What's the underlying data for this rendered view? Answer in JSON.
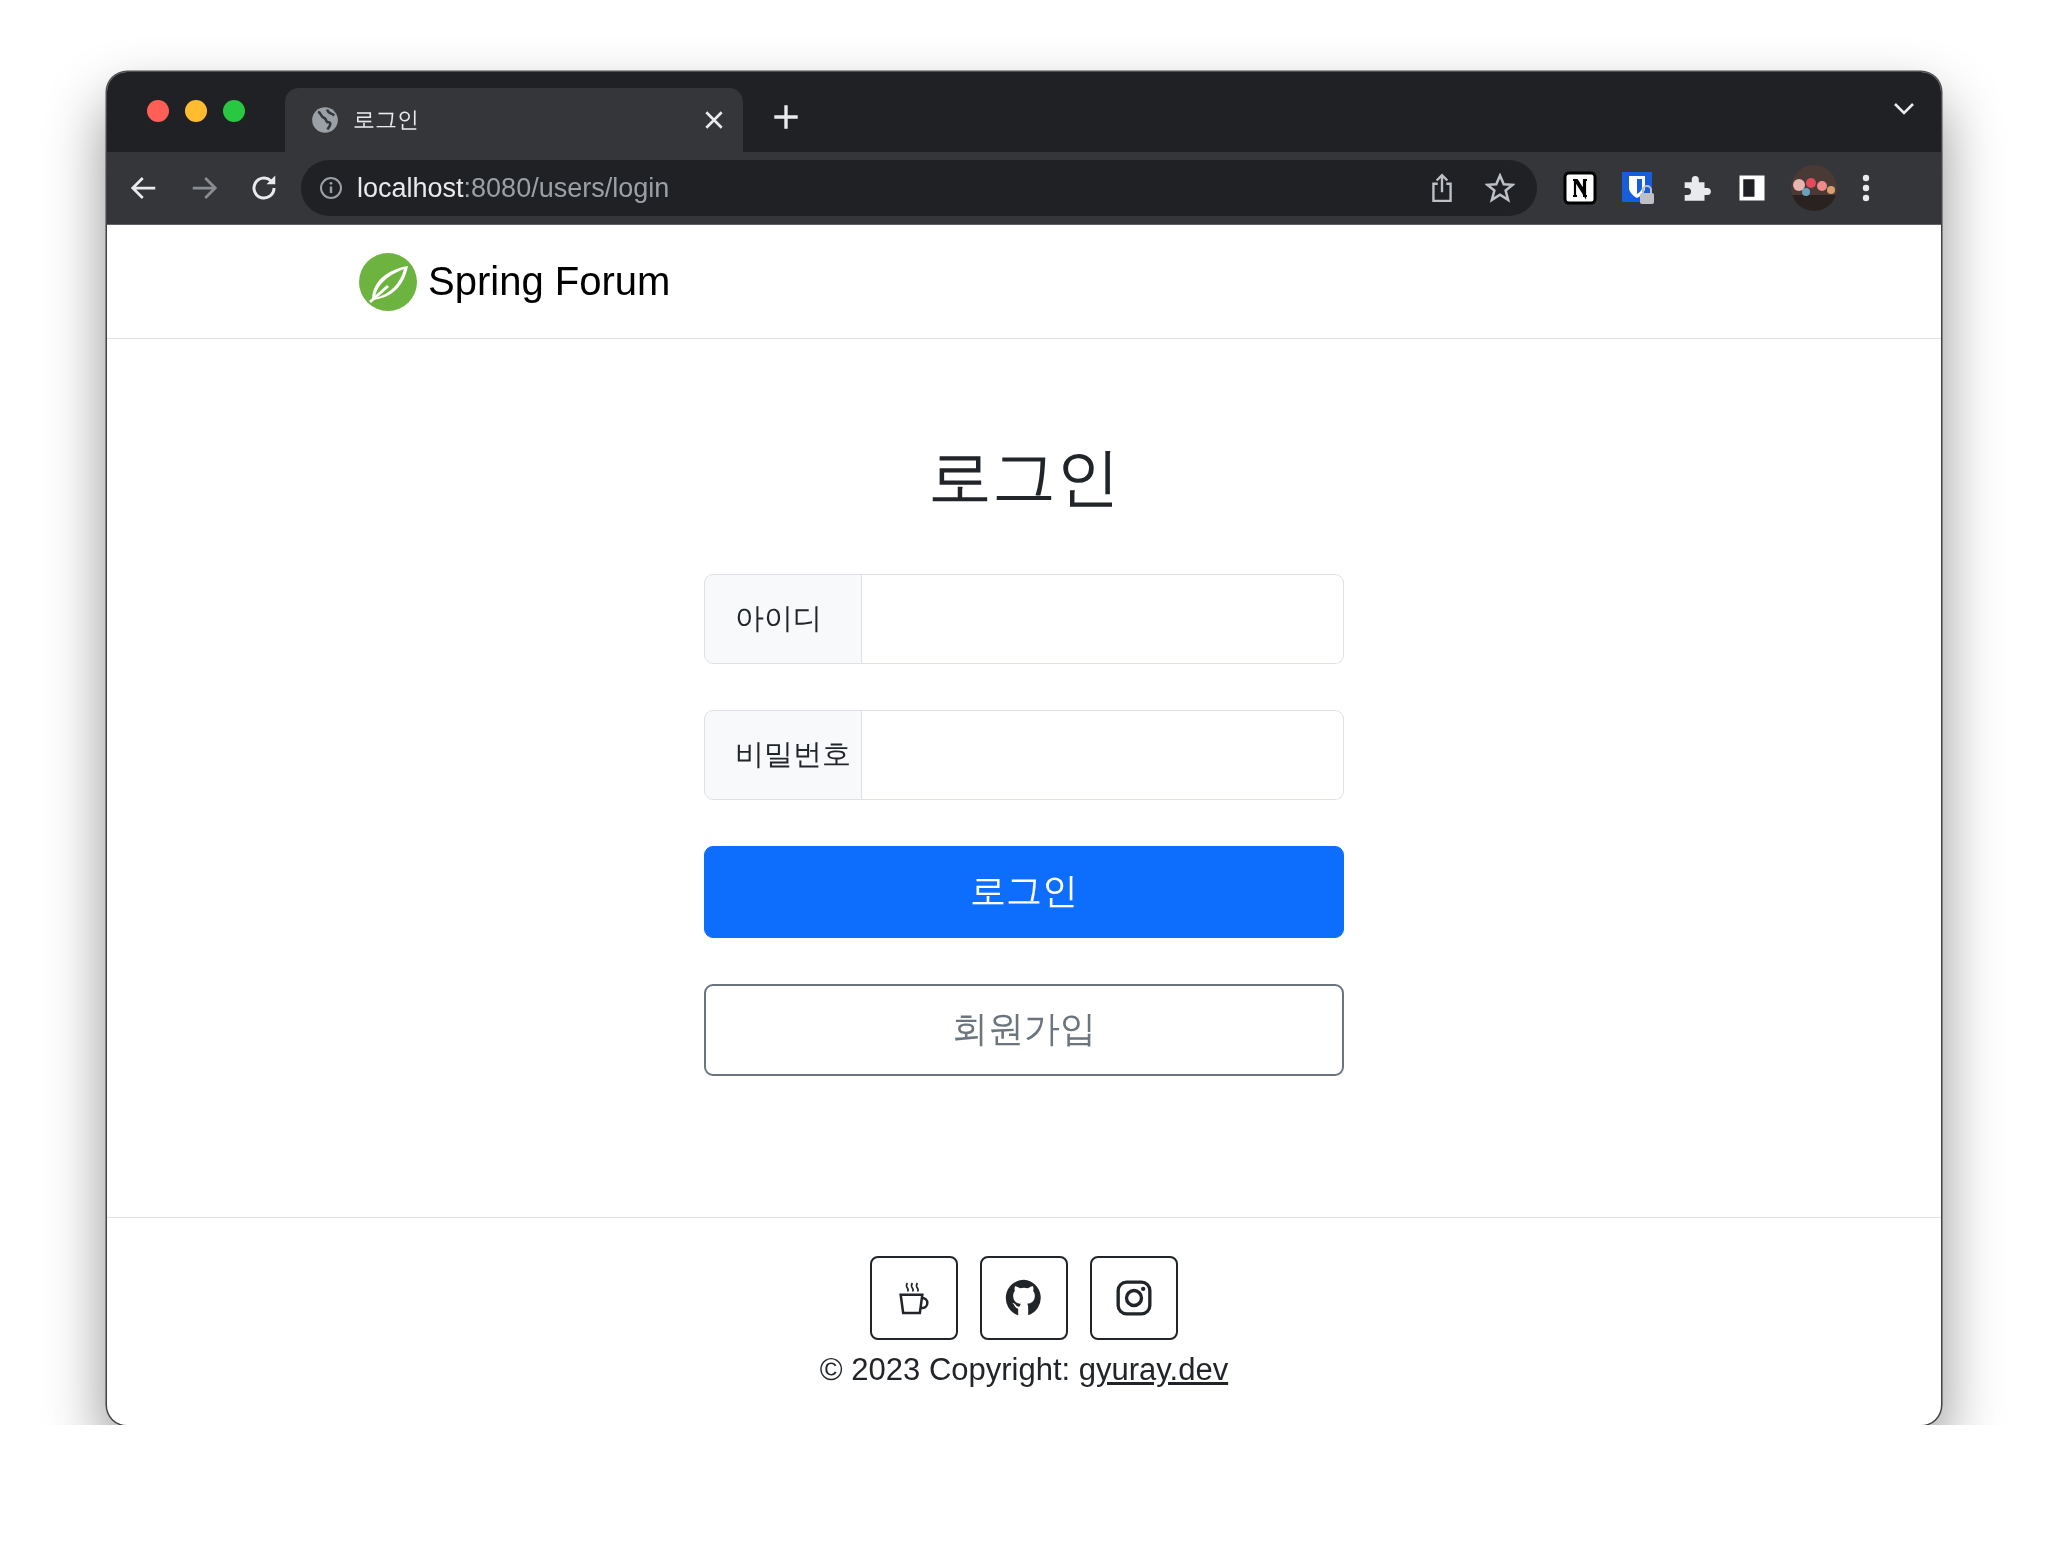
{
  "browser": {
    "tab": {
      "title": "로그인",
      "selected": true
    },
    "address": {
      "host": "localhost",
      "path": ":8080/users/login"
    }
  },
  "site": {
    "brand": "Spring Forum"
  },
  "login": {
    "title": "로그인",
    "fields": [
      {
        "label": "아이디"
      },
      {
        "label": "비밀번호"
      }
    ],
    "buttons": [
      {
        "label": "로그인",
        "kind": "primary"
      },
      {
        "label": "회원가입",
        "kind": "outline"
      }
    ]
  },
  "footer": {
    "copyright": "© 2023 Copyright: ",
    "link": "gyuray.dev"
  }
}
